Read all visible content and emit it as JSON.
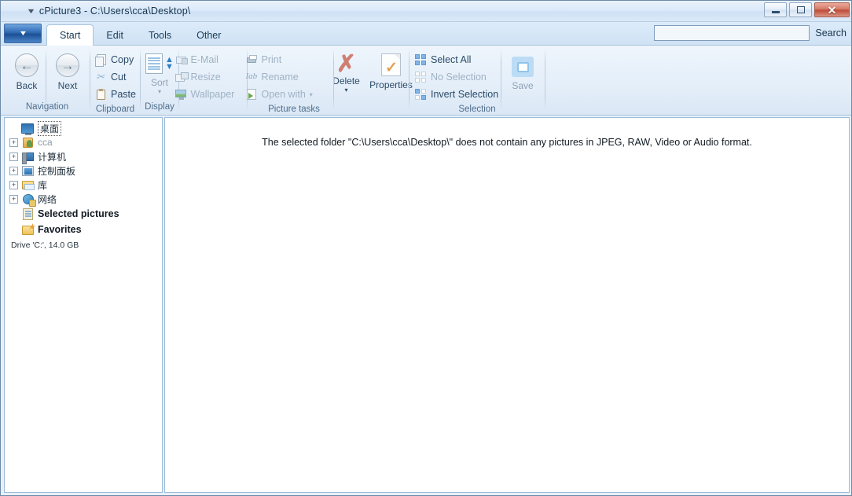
{
  "window": {
    "title": "cPicture3 - C:\\Users\\cca\\Desktop\\",
    "title_caret": "▼",
    "controls": {
      "minimize": "—",
      "maximize": "□",
      "close": "✕"
    }
  },
  "tabstrip": {
    "app_button_caret": "▼",
    "tabs": [
      {
        "label": "Start",
        "active": true
      },
      {
        "label": "Edit",
        "active": false
      },
      {
        "label": "Tools",
        "active": false
      },
      {
        "label": "Other",
        "active": false
      }
    ],
    "search": {
      "value": "",
      "placeholder": "",
      "label": "Search"
    }
  },
  "ribbon": {
    "groups": [
      {
        "name": "Navigation",
        "label": "Navigation",
        "buttons": [
          {
            "label": "Back",
            "icon": "arrow-left-icon",
            "glyph": "←"
          },
          {
            "label": "Next",
            "icon": "arrow-right-icon",
            "glyph": "→"
          }
        ]
      },
      {
        "name": "Clipboard",
        "label": "Clipboard",
        "items": [
          {
            "label": "Copy",
            "icon": "copy-icon",
            "disabled": false
          },
          {
            "label": "Cut",
            "icon": "cut-icon",
            "disabled": false
          },
          {
            "label": "Paste",
            "icon": "paste-icon",
            "disabled": false
          }
        ]
      },
      {
        "name": "Display",
        "label": "Display",
        "buttons": [
          {
            "label": "Sort",
            "icon": "sort-icon",
            "dropdown": "▾"
          }
        ]
      },
      {
        "name": "Picture tasks",
        "label": "Picture tasks",
        "column_one": [
          {
            "label": "E-Mail",
            "icon": "email-icon",
            "disabled": true
          },
          {
            "label": "Resize",
            "icon": "resize-icon",
            "disabled": true
          },
          {
            "label": "Wallpaper",
            "icon": "wallpaper-icon",
            "disabled": true
          }
        ],
        "column_two": [
          {
            "label": "Print",
            "icon": "print-icon",
            "disabled": true
          },
          {
            "label": "Rename",
            "icon": "rename-icon",
            "disabled": true
          },
          {
            "label": "Open with",
            "icon": "open-with-icon",
            "disabled": true,
            "dropdown": "▾"
          }
        ],
        "big_buttons": [
          {
            "label": "Delete",
            "icon": "delete-x-icon",
            "dropdown": "▾"
          },
          {
            "label": "Properties",
            "icon": "properties-icon"
          }
        ]
      },
      {
        "name": "Selection",
        "label": "Selection",
        "items": [
          {
            "label": "Select All",
            "icon": "select-all-icon",
            "disabled": false
          },
          {
            "label": "No Selection",
            "icon": "no-selection-icon",
            "disabled": true
          },
          {
            "label": "Invert Selection",
            "icon": "invert-selection-icon",
            "disabled": false
          }
        ],
        "big_buttons": [
          {
            "label": "Save",
            "icon": "save-icon",
            "disabled": true
          }
        ]
      }
    ]
  },
  "sidebar": {
    "tree": [
      {
        "label": "桌面",
        "icon": "desktop-icon",
        "expander": "",
        "selected": true,
        "grey": false,
        "bold": false
      },
      {
        "label": "cca",
        "icon": "user-folder-icon",
        "expander": "+",
        "selected": false,
        "grey": true,
        "bold": false
      },
      {
        "label": "计算机",
        "icon": "computer-icon",
        "expander": "+",
        "selected": false,
        "grey": false,
        "bold": false
      },
      {
        "label": "控制面板",
        "icon": "control-panel-icon",
        "expander": "+",
        "selected": false,
        "grey": false,
        "bold": false
      },
      {
        "label": "库",
        "icon": "library-icon",
        "expander": "+",
        "selected": false,
        "grey": false,
        "bold": false
      },
      {
        "label": "网络",
        "icon": "network-icon",
        "expander": "+",
        "selected": false,
        "grey": false,
        "bold": false
      },
      {
        "label": "Selected pictures",
        "icon": "selected-pictures-icon",
        "expander": "",
        "selected": false,
        "grey": false,
        "bold": true
      },
      {
        "label": "Favorites",
        "icon": "favorites-icon",
        "expander": "",
        "selected": false,
        "grey": false,
        "bold": true
      }
    ],
    "drive_info": "Drive 'C:', 14.0 GB"
  },
  "content": {
    "empty_message": "The selected folder \"C:\\Users\\cca\\Desktop\\\" does not contain any pictures in JPEG, RAW, Video or Audio format."
  },
  "colors": {
    "titlebar_accent": "#cfe1f5",
    "close_button": "#bc4a37",
    "app_button_blue": "#2f6ab3",
    "selection_blue": "#7fb6e8",
    "delete_red": "#cf7f72",
    "check_orange": "#e0a153"
  }
}
